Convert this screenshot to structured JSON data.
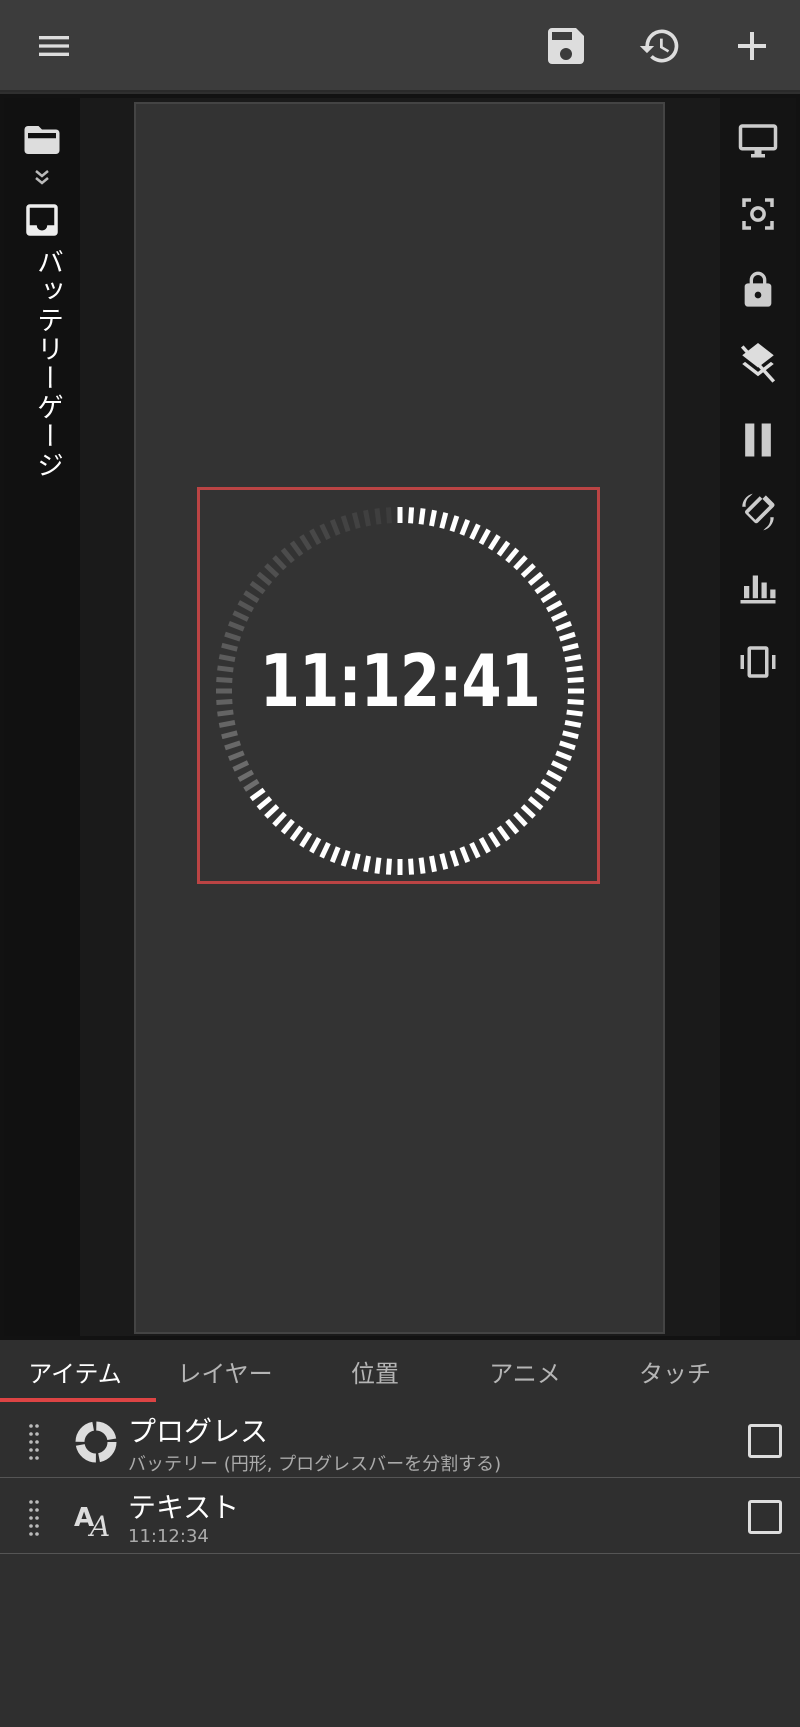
{
  "topbar": {
    "icons": [
      "menu-icon",
      "save-icon",
      "history-icon",
      "add-icon"
    ]
  },
  "left_panel": {
    "title": "バッテリーゲージ",
    "icons": [
      "folder-open-icon",
      "chevron-double-down-icon",
      "inbox-icon"
    ]
  },
  "right_panel": {
    "icons": [
      "monitor-icon",
      "screenshot-icon",
      "lock-icon",
      "layers-off-icon",
      "pause-icon",
      "screen-rotation-icon",
      "bar-chart-icon",
      "vibration-icon"
    ]
  },
  "canvas": {
    "clock_text": "11:12:41",
    "progress_fraction": 0.66,
    "accent_color": "#bb4444"
  },
  "tabs": [
    {
      "label": "アイテム",
      "active": true
    },
    {
      "label": "レイヤー",
      "active": false
    },
    {
      "label": "位置",
      "active": false
    },
    {
      "label": "アニメ",
      "active": false
    },
    {
      "label": "タッチ",
      "active": false
    }
  ],
  "items": [
    {
      "title": "プログレス",
      "subtitle": "バッテリー (円形, プログレスバーを分割する)",
      "icon": "progress-ring-icon",
      "checked": false
    },
    {
      "title": "テキスト",
      "subtitle": "11:12:34",
      "icon": "text-format-icon",
      "checked": false
    }
  ]
}
